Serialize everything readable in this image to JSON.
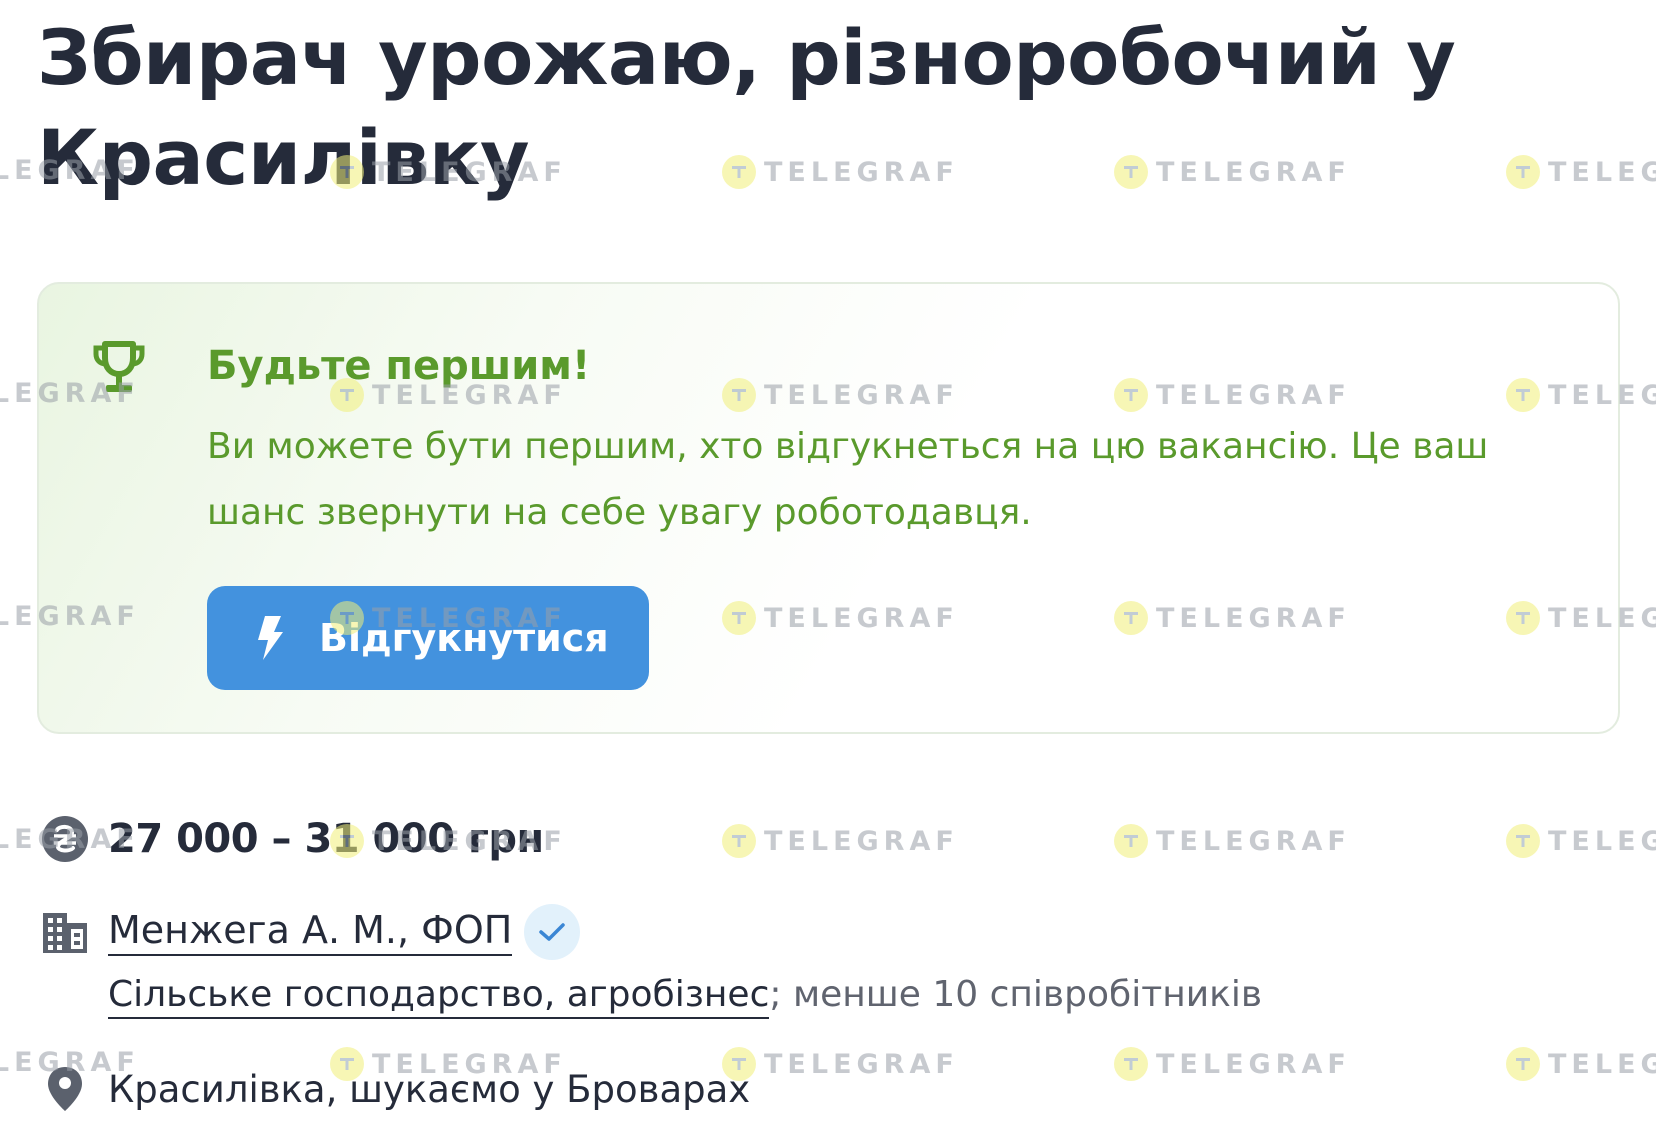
{
  "vacancy": {
    "title": "Збирач урожаю, різноробочий у Красилівку"
  },
  "promo": {
    "icon": "trophy-icon",
    "heading": "Будьте першим!",
    "text": "Ви можете бути першим, хто відгукнеться на цю вакансію. Це ваш шанс звернути на себе увагу роботодавця.",
    "apply_button": "Відгукнутися",
    "accent_color": "#5a9a2c",
    "button_color": "#4392de"
  },
  "details": {
    "salary": "27 000 – 31 000 грн",
    "company": "Менжега А. М., ФОП",
    "company_verified": true,
    "industry": "Сільське господарство, агробізнес",
    "company_size": "; менше 10 співробітників",
    "location": "Красилівка, шукаємо у Броварах"
  },
  "watermark": {
    "text": "TELEGRAF"
  }
}
